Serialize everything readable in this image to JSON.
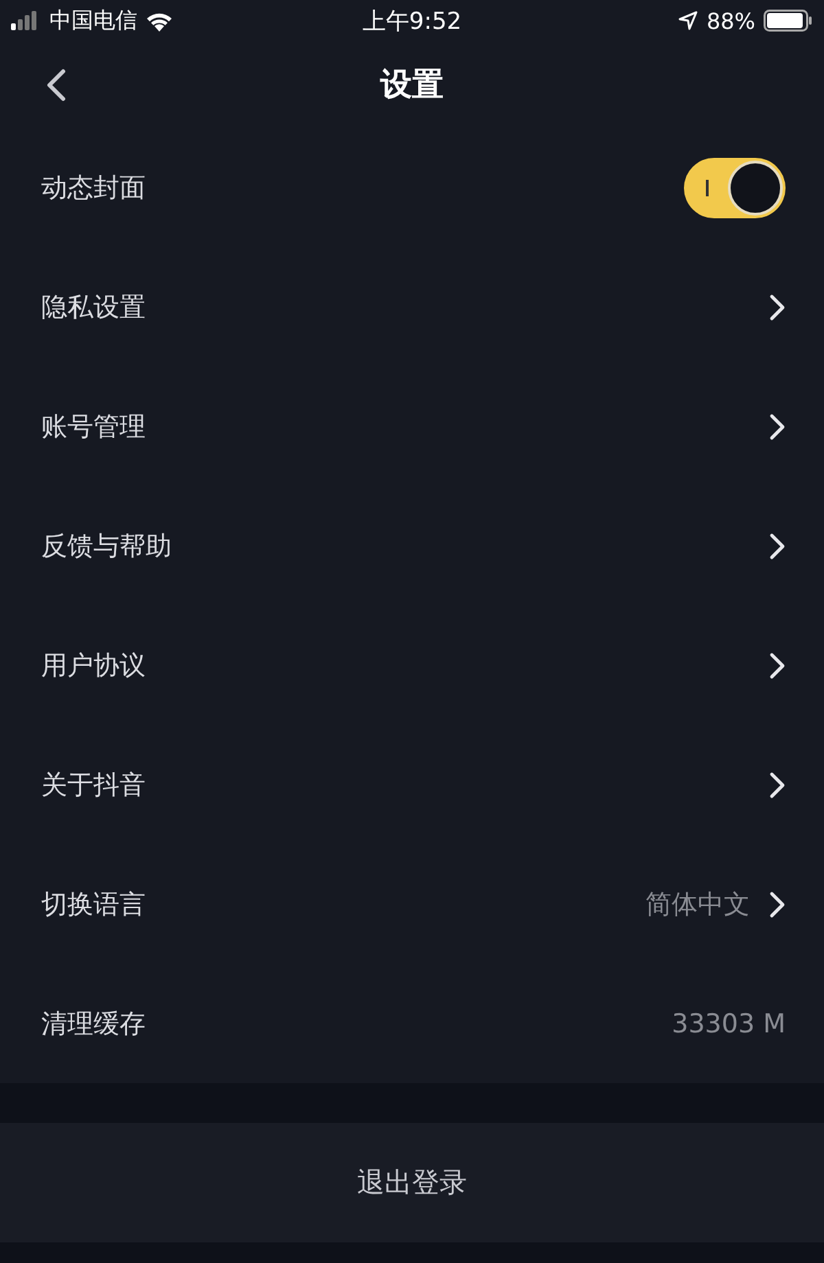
{
  "status_bar": {
    "carrier": "中国电信",
    "time": "上午9:52",
    "battery": "88%"
  },
  "nav": {
    "title": "设置"
  },
  "items": [
    {
      "kind": "toggle",
      "label": "动态封面",
      "on": true
    },
    {
      "kind": "link",
      "label": "隐私设置"
    },
    {
      "kind": "link",
      "label": "账号管理"
    },
    {
      "kind": "link",
      "label": "反馈与帮助"
    },
    {
      "kind": "link",
      "label": "用户协议"
    },
    {
      "kind": "link",
      "label": "关于抖音"
    },
    {
      "kind": "link",
      "label": "切换语言",
      "value": "简体中文"
    },
    {
      "kind": "value",
      "label": "清理缓存",
      "value": "33303 M"
    }
  ],
  "logout_button": "退出登录"
}
